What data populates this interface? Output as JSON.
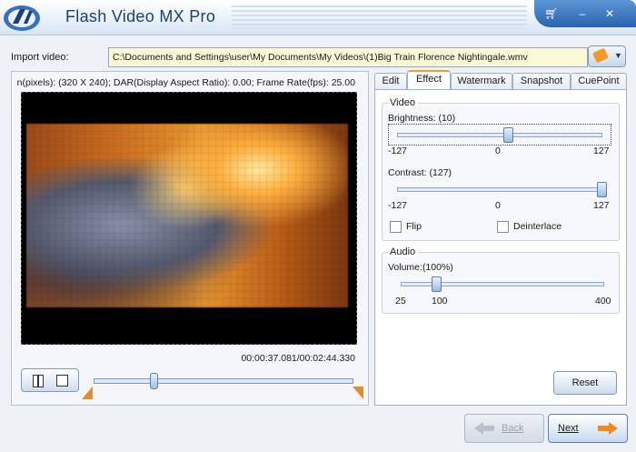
{
  "window": {
    "title": "Flash Video MX Pro"
  },
  "import": {
    "label": "Import video:",
    "path": "C:\\Documents and Settings\\user\\My Documents\\My Videos\\(1)Big Train  Florence Nightingale.wmv"
  },
  "preview": {
    "info_text": "n(pixels): (320 X 240);  DAR(Display Aspect Ratio): 0.00;  Frame Rate(fps): 25.00",
    "time_readout": "00:00:37.081/00:02:44.330",
    "seek_position": 0.23
  },
  "tabs": [
    {
      "label": "Edit"
    },
    {
      "label": "Effect"
    },
    {
      "label": "Watermark"
    },
    {
      "label": "Snapshot"
    },
    {
      "label": "CuePoint"
    }
  ],
  "video_group": {
    "title": "Video",
    "brightness": {
      "label": "Brightness:  (10)",
      "value": 10,
      "min_label": "-127",
      "mid_label": "0",
      "max_label": "127"
    },
    "contrast": {
      "label": "Contrast:  (127)",
      "value": 127,
      "min_label": "-127",
      "mid_label": "0",
      "max_label": "127"
    },
    "flip_label": "Flip",
    "deinterlace_label": "Deinterlace"
  },
  "audio_group": {
    "title": "Audio",
    "volume": {
      "label": "Volume:(100%)",
      "value": 100,
      "tick_labels": [
        "25",
        "100",
        "400"
      ]
    }
  },
  "buttons": {
    "reset": "Reset",
    "back": "Back",
    "next": "Next"
  },
  "colors": {
    "accent": "#f0a030",
    "title_text": "#1d3f78"
  }
}
